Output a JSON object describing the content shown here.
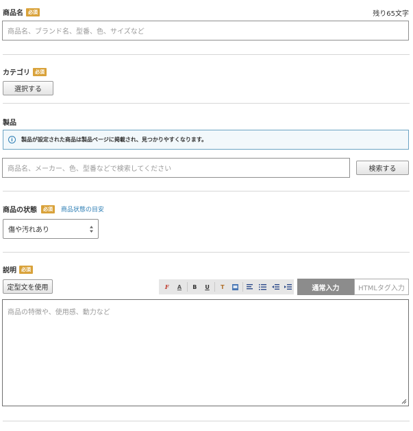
{
  "product_name": {
    "label": "商品名",
    "required": "必須",
    "remaining": "残り65文字",
    "placeholder": "商品名、ブランド名、型番、色、サイズなど"
  },
  "category": {
    "label": "カテゴリ",
    "required": "必須",
    "select_button": "選択する"
  },
  "product": {
    "label": "製品",
    "info_text": "製品が設定された商品は製品ページに掲載され、見つかりやすくなります。",
    "search_placeholder": "商品名、メーカー、色、型番などで検索してください",
    "search_button": "検索する"
  },
  "condition": {
    "label": "商品の状態",
    "required": "必須",
    "guide_link": "商品状態の目安",
    "selected": "傷や汚れあり"
  },
  "description": {
    "label": "説明",
    "required": "必須",
    "template_button": "定型文を使用",
    "mode_normal": "通常入力",
    "mode_html": "HTMLタグ入力",
    "placeholder": "商品の特徴や、使用感、動力など",
    "toolbar": {
      "font": "F",
      "size": "A",
      "bold": "B",
      "underline": "U",
      "color": "T",
      "bg": "A"
    }
  },
  "colors": {
    "required_badge": "#d9a23a",
    "link": "#2f7fb5",
    "info_border": "#6aa3c3",
    "mode_active_bg": "#8c8c8c"
  }
}
